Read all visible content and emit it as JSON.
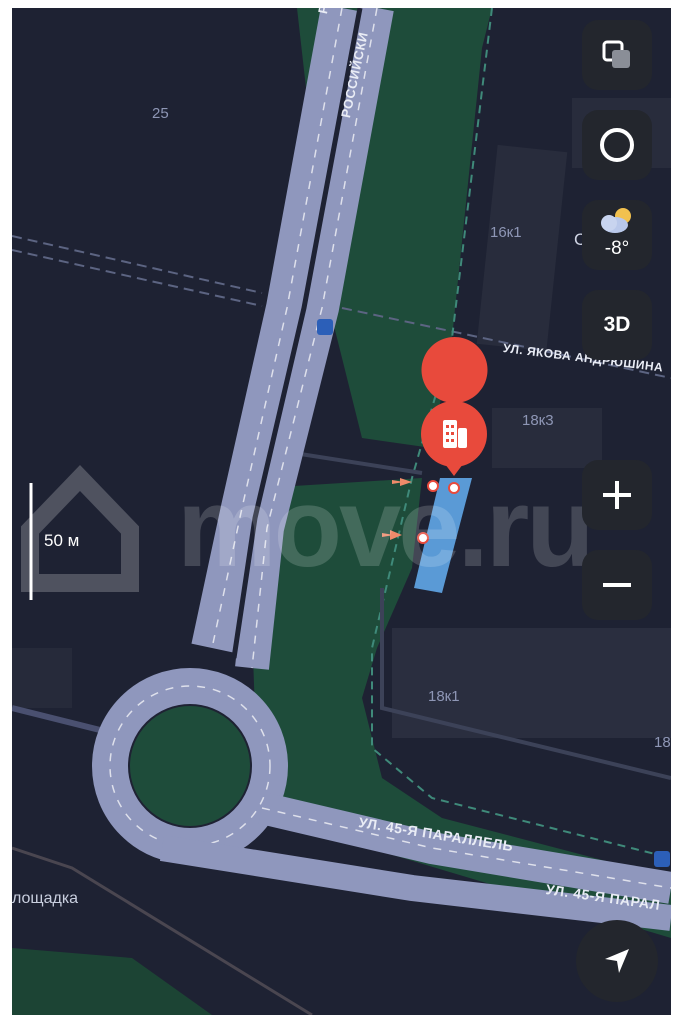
{
  "map": {
    "house_numbers": [
      "25",
      "16к1",
      "18к3",
      "18к1",
      "18"
    ],
    "streets": {
      "rossiyskiy_1": "РО",
      "rossiyskiy_2": "РОССИЙСКИ",
      "yakova": "УЛ. ЯКОВА АНДРЮШИНА",
      "parallel_1": "УЛ. 45-Я ПАРАЛЛЕЛЬ",
      "parallel_2": "УЛ. 45-Я ПАРАЛ"
    },
    "poi_partial": "С",
    "area_label": "лощадка",
    "scale_label": "50 м",
    "watermark": "move.ru",
    "selected_place_icon": "building-icon"
  },
  "controls": {
    "layers_icon": "layers-icon",
    "camera_icon": "circle-icon",
    "weather": {
      "icon": "partly-cloudy-icon",
      "temperature": "-8°"
    },
    "mode_3d_label": "3D",
    "zoom_in_icon": "plus-icon",
    "zoom_out_icon": "minus-icon",
    "locate_icon": "navigation-arrow-icon"
  },
  "colors": {
    "background": "#1e2233",
    "road": "#8f97bd",
    "green": "#1e4c3a",
    "selected_building": "#5a9ad6",
    "pin": "#e84a3c",
    "control_bg": "#23262d"
  }
}
